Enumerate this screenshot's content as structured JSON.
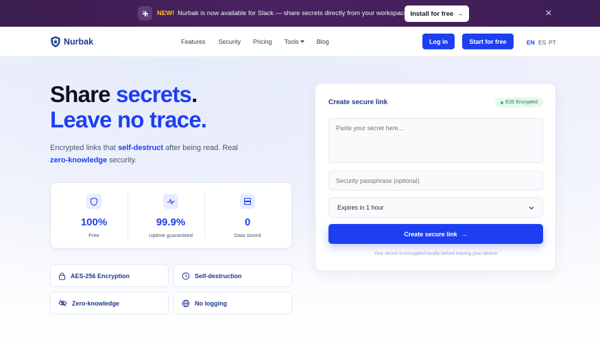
{
  "announcement": {
    "new_label": "NEW!",
    "text": "Nurbak is now available for Slack — share secrets directly from your workspace",
    "install_label": "Install for free",
    "install_arrow": "→",
    "close_glyph": "✕"
  },
  "nav": {
    "logo_text": "Nurbak",
    "links": [
      {
        "label": "Features"
      },
      {
        "label": "Security"
      },
      {
        "label": "Pricing"
      },
      {
        "label": "Tools",
        "has_dropdown": true
      },
      {
        "label": "Blog"
      }
    ],
    "login_label": "Log in",
    "start_label": "Start for free",
    "languages": [
      "EN",
      "ES",
      "PT"
    ],
    "active_language": "EN"
  },
  "hero": {
    "line1_dark": "Share ",
    "line1_blue": "secrets",
    "line1_dot": ".",
    "line2_blue": "Leave no trace.",
    "sub_part1": "Encrypted links that ",
    "sub_hl1": "self-destruct",
    "sub_part2": " after being read. Real ",
    "sub_hl2": "zero-knowledge",
    "sub_part3": " security."
  },
  "stats": [
    {
      "value": "100%",
      "label": "Free",
      "icon": "shield-icon"
    },
    {
      "value": "99.9%",
      "label": "Uptime guaranteed",
      "icon": "activity-icon"
    },
    {
      "value": "0",
      "label": "Data stored",
      "icon": "server-icon"
    }
  ],
  "features": [
    {
      "label": "AES-256 Encryption",
      "icon": "lock-icon"
    },
    {
      "label": "Self-destruction",
      "icon": "clock-icon"
    },
    {
      "label": "Zero-knowledge",
      "icon": "eye-off-icon"
    },
    {
      "label": "No logging",
      "icon": "globe-icon"
    }
  ],
  "form": {
    "title": "Create secure link",
    "badge": "E2E Encrypted",
    "secret_placeholder": "Paste your secret here...",
    "passphrase_placeholder": "Security passphrase (optional)",
    "expires_value": "Expires in 1 hour",
    "submit_label": "Create secure link",
    "submit_arrow": "→",
    "note": "Your secret is encrypted locally before leaving your device."
  },
  "colors": {
    "brand_blue": "#1d3ff1",
    "banner_purple": "#4a2160",
    "success_green": "#15803d"
  }
}
